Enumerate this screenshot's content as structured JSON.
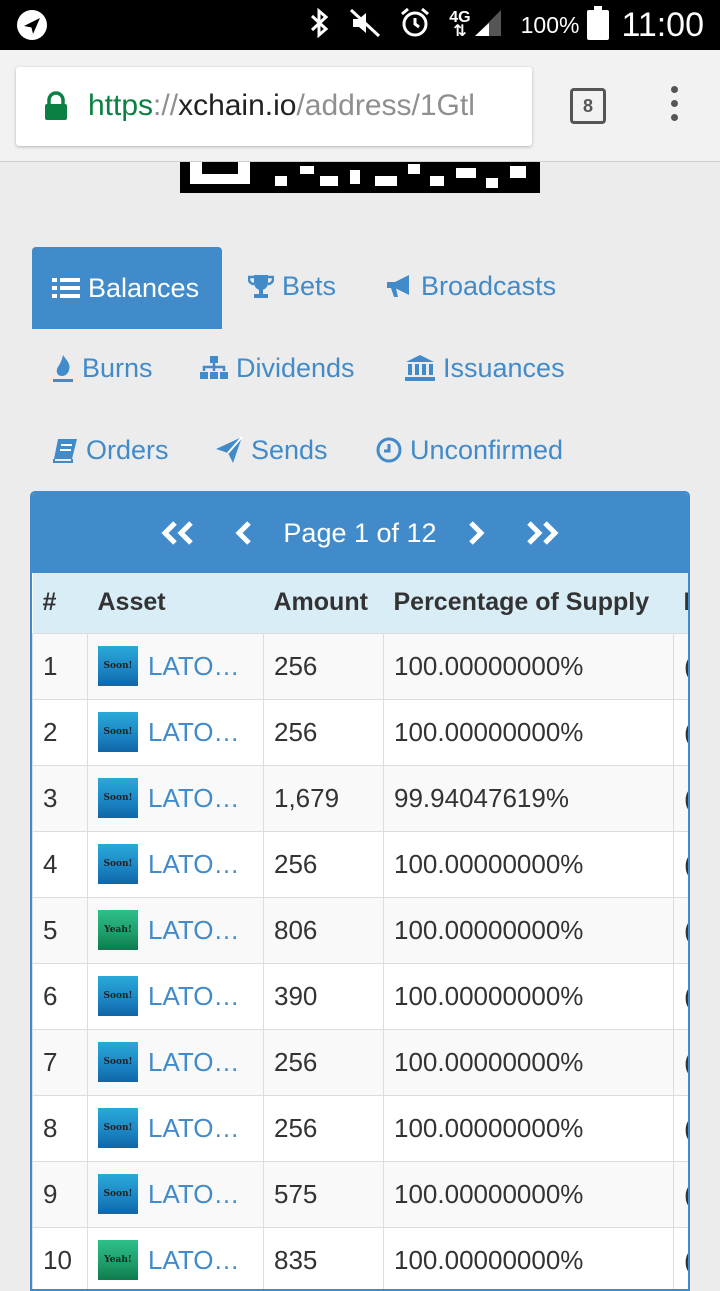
{
  "status_bar": {
    "battery_percent": "100%",
    "time": "11:00",
    "network": "4G"
  },
  "browser": {
    "url_scheme": "https",
    "url_sep": "://",
    "url_host": "xchain.io",
    "url_path": "/address/1Gtl",
    "tab_count": "8"
  },
  "nav": {
    "balances": "Balances",
    "bets": "Bets",
    "broadcasts": "Broadcasts",
    "burns": "Burns",
    "dividends": "Dividends",
    "issuances": "Issuances",
    "orders": "Orders",
    "sends": "Sends",
    "unconfirmed": "Unconfirmed"
  },
  "pager": {
    "text": "Page 1 of 12"
  },
  "table": {
    "headers": [
      "#",
      "Asset",
      "Amount",
      "Percentage of Supply"
    ],
    "rows": [
      {
        "num": "1",
        "icon": "soon",
        "icon_text": "Soon!",
        "asset": "LATO…",
        "amount": "256",
        "pct": "100.00000000%"
      },
      {
        "num": "2",
        "icon": "soon",
        "icon_text": "Soon!",
        "asset": "LATO…",
        "amount": "256",
        "pct": "100.00000000%"
      },
      {
        "num": "3",
        "icon": "soon",
        "icon_text": "Soon!",
        "asset": "LATO…",
        "amount": "1,679",
        "pct": "99.94047619%"
      },
      {
        "num": "4",
        "icon": "soon",
        "icon_text": "Soon!",
        "asset": "LATO…",
        "amount": "256",
        "pct": "100.00000000%"
      },
      {
        "num": "5",
        "icon": "yeah",
        "icon_text": "Yeah!",
        "asset": "LATO…",
        "amount": "806",
        "pct": "100.00000000%"
      },
      {
        "num": "6",
        "icon": "soon",
        "icon_text": "Soon!",
        "asset": "LATO…",
        "amount": "390",
        "pct": "100.00000000%"
      },
      {
        "num": "7",
        "icon": "soon",
        "icon_text": "Soon!",
        "asset": "LATO…",
        "amount": "256",
        "pct": "100.00000000%"
      },
      {
        "num": "8",
        "icon": "soon",
        "icon_text": "Soon!",
        "asset": "LATO…",
        "amount": "256",
        "pct": "100.00000000%"
      },
      {
        "num": "9",
        "icon": "soon",
        "icon_text": "Soon!",
        "asset": "LATO…",
        "amount": "575",
        "pct": "100.00000000%"
      },
      {
        "num": "10",
        "icon": "yeah",
        "icon_text": "Yeah!",
        "asset": "LATO…",
        "amount": "835",
        "pct": "100.00000000%"
      }
    ]
  },
  "colors": {
    "accent": "#428bca",
    "header_bg": "#d9edf7",
    "url_secure": "#0b8043"
  }
}
